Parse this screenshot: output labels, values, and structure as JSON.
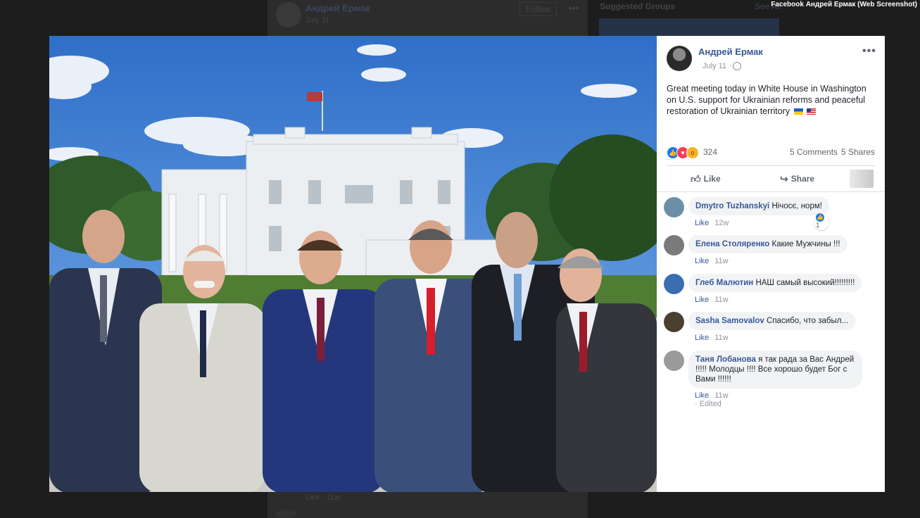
{
  "watermark": "Facebook Андрей Ермак (Web Screenshot)",
  "background": {
    "author": "Андрей Ермак",
    "date": "July 11",
    "follow_label": "Follow",
    "sidebar_title": "Suggested Groups",
    "see_all": "See All",
    "like_line": "Like · 11w"
  },
  "post": {
    "author": "Андрей Ермак",
    "date": "July 11 ·",
    "text": "Great meeting today in White House in Washington on U.S. support for Ukrainian reforms and peaceful restoration of Ukrainian territory",
    "reaction_count": "324",
    "comments_label": "5 Comments",
    "shares_label": "5 Shares",
    "like_label": "Like",
    "share_label": "Share"
  },
  "comments": [
    {
      "author": "Dmytro Tuzhanskyi",
      "text": "Нічосє, норм!",
      "like": "Like",
      "time": "12w",
      "reaction_count": "1",
      "avatar_color": "#6c8fa8"
    },
    {
      "author": "Елена Столяренко",
      "text": "Какие Мужчины !!!",
      "like": "Like",
      "time": "11w",
      "avatar_color": "#7a7a7a"
    },
    {
      "author": "Глеб Малютин",
      "text": "НАШ самый высокий!!!!!!!!!",
      "like": "Like",
      "time": "11w",
      "avatar_color": "#3b6db3"
    },
    {
      "author": "Sasha Samovalov",
      "text": "Спасибо, что забыл...",
      "like": "Like",
      "time": "11w",
      "avatar_color": "#4a4030"
    },
    {
      "author": "Таня Лобанова",
      "text": "я так рада за Вас Андрей !!!!! Молодцы !!!! Все хорошо будет Бог с Вами !!!!!!",
      "like": "Like",
      "time": "11w",
      "edited": "Edited",
      "avatar_color": "#9a9a9a"
    }
  ]
}
